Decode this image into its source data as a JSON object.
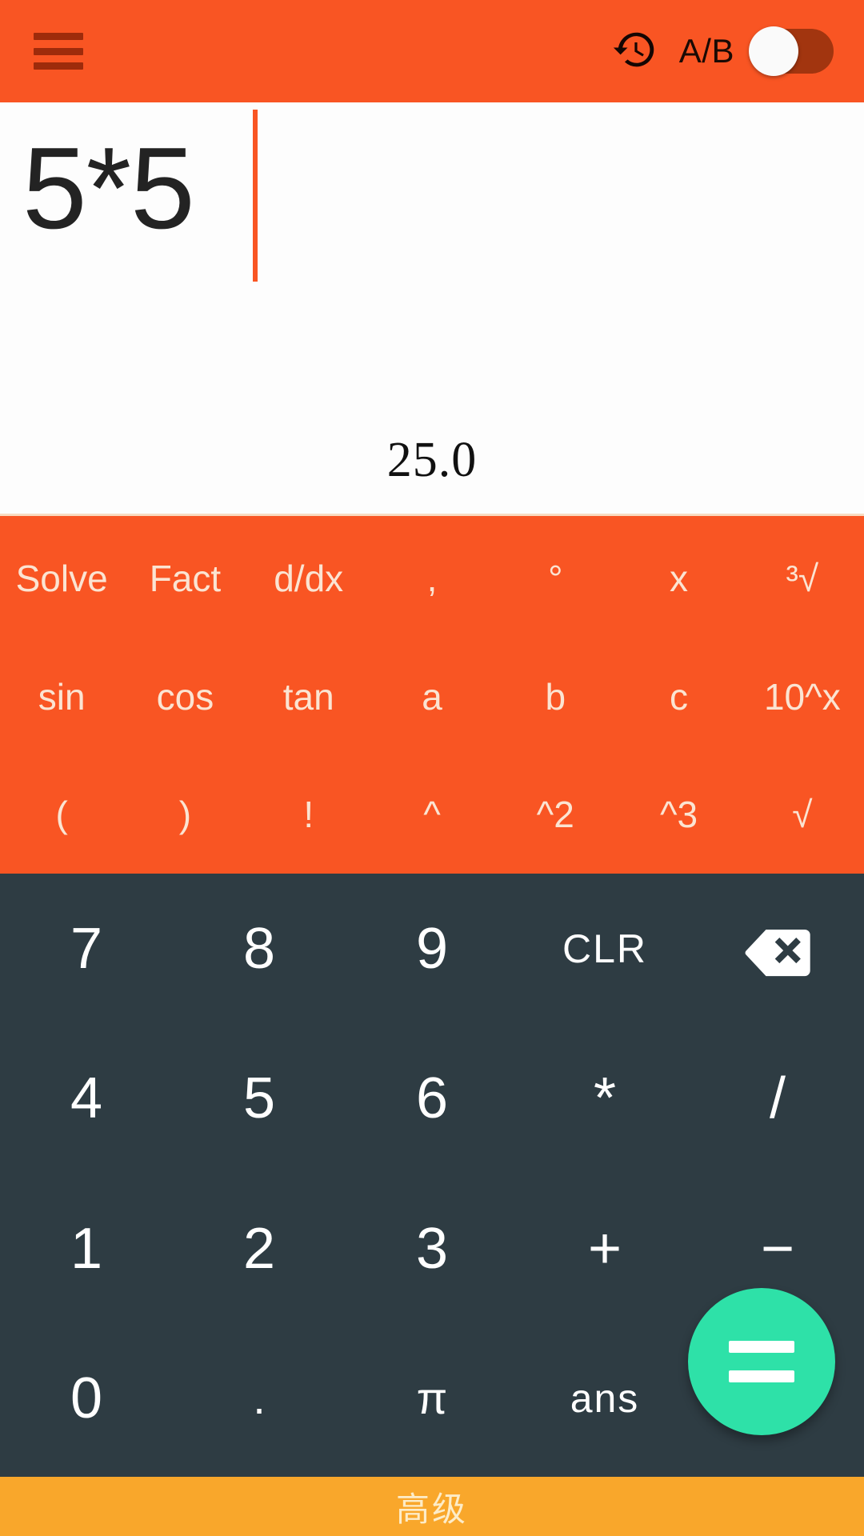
{
  "header": {
    "menu_icon": "hamburger-menu-icon",
    "history_icon": "history-clock-icon",
    "ab_label": "A/B",
    "toggle_state": "off"
  },
  "display": {
    "expression": "5*5",
    "result": "25.0"
  },
  "function_pad": {
    "rows": [
      [
        {
          "label": "Solve",
          "name": "solve"
        },
        {
          "label": "Fact",
          "name": "fact"
        },
        {
          "label": "d/dx",
          "name": "ddx"
        },
        {
          "label": ",",
          "name": "comma"
        },
        {
          "label": "°",
          "name": "degree"
        },
        {
          "label": "x",
          "name": "variable-x"
        },
        {
          "label": "³√",
          "name": "cube-root"
        }
      ],
      [
        {
          "label": "sin",
          "name": "sin"
        },
        {
          "label": "cos",
          "name": "cos"
        },
        {
          "label": "tan",
          "name": "tan"
        },
        {
          "label": "a",
          "name": "variable-a"
        },
        {
          "label": "b",
          "name": "variable-b"
        },
        {
          "label": "c",
          "name": "variable-c"
        },
        {
          "label": "10^x",
          "name": "ten-power-x"
        }
      ],
      [
        {
          "label": "(",
          "name": "paren-open"
        },
        {
          "label": ")",
          "name": "paren-close"
        },
        {
          "label": "!",
          "name": "factorial"
        },
        {
          "label": "^",
          "name": "power"
        },
        {
          "label": "^2",
          "name": "square"
        },
        {
          "label": "^3",
          "name": "cube"
        },
        {
          "label": "√",
          "name": "square-root"
        }
      ]
    ]
  },
  "num_pad": {
    "rows": [
      [
        {
          "label": "7",
          "name": "digit-7"
        },
        {
          "label": "8",
          "name": "digit-8"
        },
        {
          "label": "9",
          "name": "digit-9"
        },
        {
          "label": "CLR",
          "name": "clear"
        },
        {
          "label": "",
          "name": "backspace",
          "icon": "backspace-icon"
        }
      ],
      [
        {
          "label": "4",
          "name": "digit-4"
        },
        {
          "label": "5",
          "name": "digit-5"
        },
        {
          "label": "6",
          "name": "digit-6"
        },
        {
          "label": "*",
          "name": "multiply"
        },
        {
          "label": "/",
          "name": "divide"
        }
      ],
      [
        {
          "label": "1",
          "name": "digit-1"
        },
        {
          "label": "2",
          "name": "digit-2"
        },
        {
          "label": "3",
          "name": "digit-3"
        },
        {
          "label": "+",
          "name": "plus"
        },
        {
          "label": "−",
          "name": "minus"
        }
      ],
      [
        {
          "label": "0",
          "name": "digit-0"
        },
        {
          "label": ".",
          "name": "decimal-point"
        },
        {
          "label": "π",
          "name": "pi"
        },
        {
          "label": "ans",
          "name": "answer"
        },
        {
          "label": "",
          "name": "equals-placeholder"
        }
      ]
    ],
    "equals_label": "="
  },
  "bottom_bar": {
    "label": "高级"
  },
  "colors": {
    "accent_orange": "#F95523",
    "keypad_dark": "#2E3C43",
    "equals_green": "#2EE1A8",
    "bottom_amber": "#F9A72B",
    "menu_maroon": "#9E2B0B",
    "func_text": "#FBE4D2"
  }
}
